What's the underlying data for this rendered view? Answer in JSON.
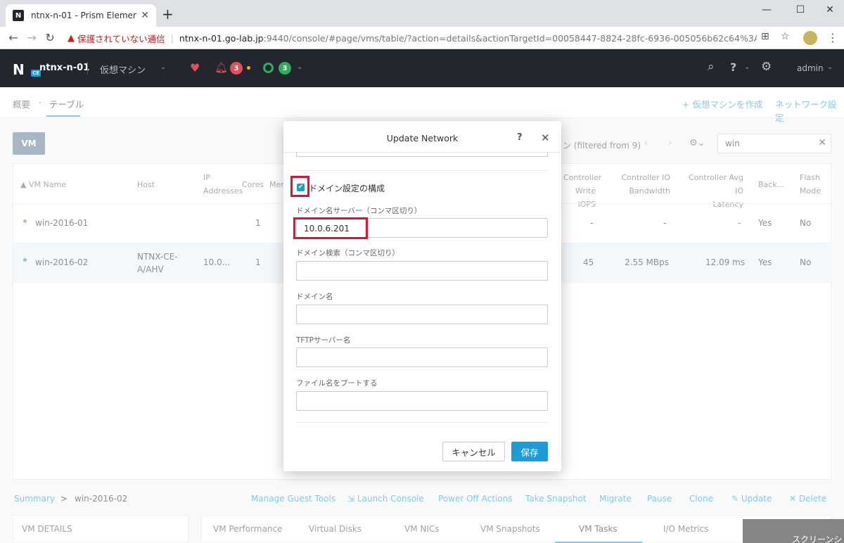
{
  "browser": {
    "tab_title": "ntnx-n-01 - Prism Element",
    "favicon": "N",
    "new_tab": "+",
    "minimize": "—",
    "maximize": "☐",
    "close": "✕",
    "security_warning": "保護されていない通信",
    "url_host": "ntnx-n-01.go-lab.jp",
    "url_path": ":9440/console/#page/vms/table/?action=details&actionTargetId=00058447-8824-28fc-6936-005056b62c64%3A%3A2b60f612-b2..."
  },
  "topnav": {
    "logo": "N",
    "logo_badge": "CE",
    "cluster_name": "ntnx-n-01",
    "menu": "仮想マシン",
    "alert_count": "3",
    "health_count": "3",
    "user": "admin"
  },
  "subnav": {
    "overview": "概要",
    "dot": "·",
    "table": "テーブル",
    "create_vm": "+ 仮想マシンを作成",
    "network_config": "ネットワーク設定"
  },
  "toolbar": {
    "vm_button": "VM",
    "filter_text": "ン (filtered from 9)",
    "search_value": "win"
  },
  "table": {
    "headers": {
      "vm_name": "▲ VM Name",
      "host": "Host",
      "ip_1": "IP",
      "ip_2": "Addresses",
      "cores": "Cores",
      "memory": "Mem",
      "ctrl_write_1": "Controller",
      "ctrl_write_2": "Write IOPS",
      "ctrl_bw_1": "Controller IO",
      "ctrl_bw_2": "Bandwidth",
      "ctrl_lat_1": "Controller Avg IO",
      "ctrl_lat_2": "Latency",
      "backup": "Back...",
      "flash_1": "Flash",
      "flash_2": "Mode"
    },
    "rows": [
      {
        "name": "win-2016-01",
        "host_1": "",
        "host_2": "",
        "ip": "",
        "cores": "1",
        "write_iops": "-",
        "bandwidth": "-",
        "latency": "-",
        "backup": "Yes",
        "flash": "No",
        "status_color": "#e8614e"
      },
      {
        "name": "win-2016-02",
        "host_1": "NTNX-CE-",
        "host_2": "A/AHV",
        "ip": "10.0...",
        "cores": "1",
        "write_iops": "45",
        "bandwidth": "2.55 MBps",
        "latency": "12.09 ms",
        "backup": "Yes",
        "flash": "No",
        "status_color": "#2fad5e"
      }
    ]
  },
  "bottom": {
    "summary": "Summary",
    "arrow": ">",
    "vm": "win-2016-02",
    "actions": {
      "guest_tools": "Manage Guest Tools",
      "console": "⇲ Launch Console",
      "power": "Power Off Actions",
      "snapshot": "Take Snapshot",
      "migrate": "Migrate",
      "pause": "Pause",
      "clone": "Clone",
      "update": "✎ Update",
      "delete": "✕ Delete"
    },
    "vm_details": "VM DETAILS",
    "tabs": {
      "performance": "VM Performance",
      "disks": "Virtual Disks",
      "nics": "VM NICs",
      "snapshots": "VM Snapshots",
      "tasks": "VM Tasks",
      "io": "I/O Metrics"
    },
    "screenshot_tip": "スクリーンショット"
  },
  "modal": {
    "title": "Update Network",
    "help": "?",
    "close": "✕",
    "checkbox_label": "ドメイン設定の構成",
    "checkbox_checked": true,
    "dns_label": "ドメイン名サーバー（コンマ区切り）",
    "dns_value": "10.0.6.201",
    "search_label": "ドメイン検索（コンマ区切り）",
    "search_value": "",
    "domain_label": "ドメイン名",
    "domain_value": "",
    "tftp_label": "TFTPサーバー名",
    "tftp_value": "",
    "boot_label": "ファイル名をブートする",
    "boot_value": "",
    "cancel": "キャンセル",
    "save": "保存"
  },
  "colors": {
    "accent": "#1f9cd6",
    "highlight": "#e8112d",
    "nav_bg": "#22272e"
  }
}
